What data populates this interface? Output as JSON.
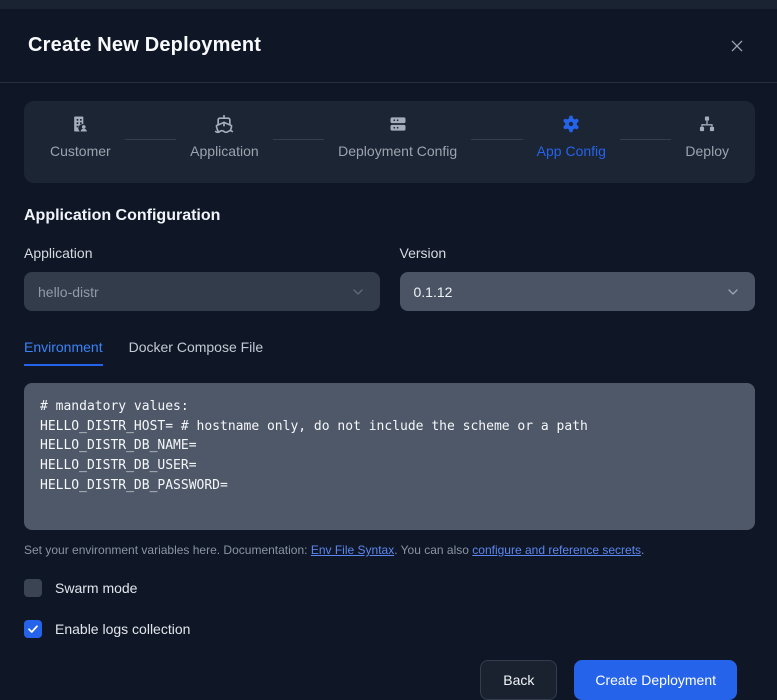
{
  "modal": {
    "title": "Create New Deployment",
    "close_icon": "x-icon"
  },
  "stepper": {
    "steps": [
      {
        "label": "Customer",
        "icon": "building-user-icon",
        "active": false
      },
      {
        "label": "Application",
        "icon": "ship-icon",
        "active": false
      },
      {
        "label": "Deployment Config",
        "icon": "server-icon",
        "active": false
      },
      {
        "label": "App Config",
        "icon": "gear-icon",
        "active": true
      },
      {
        "label": "Deploy",
        "icon": "network-icon",
        "active": false
      }
    ]
  },
  "section": {
    "heading": "Application Configuration"
  },
  "form": {
    "application": {
      "label": "Application",
      "value": "hello-distr",
      "state": "disabled"
    },
    "version": {
      "label": "Version",
      "value": "0.1.12",
      "state": "enabled"
    }
  },
  "tabs": [
    {
      "label": "Environment",
      "active": true
    },
    {
      "label": "Docker Compose File",
      "active": false
    }
  ],
  "editor": {
    "content": "# mandatory values:\nHELLO_DISTR_HOST= # hostname only, do not include the scheme or a path\nHELLO_DISTR_DB_NAME=\nHELLO_DISTR_DB_USER=\nHELLO_DISTR_DB_PASSWORD="
  },
  "helper": {
    "prefix": "Set your environment variables here. Documentation: ",
    "link_env": "Env File Syntax",
    "middle": ". You can also ",
    "link_secrets": "configure and reference secrets",
    "suffix": "."
  },
  "checkboxes": [
    {
      "label": "Swarm mode",
      "checked": false
    },
    {
      "label": "Enable logs collection",
      "checked": true
    }
  ],
  "footer": {
    "back_label": "Back",
    "create_label": "Create Deployment"
  },
  "colors": {
    "accent": "#2563eb",
    "modal_bg": "#0f1726",
    "stepper_bg": "#1c2534",
    "field_bg": "#4a5464",
    "field_disabled_bg": "#333c4b",
    "editor_bg": "#4e5868"
  }
}
